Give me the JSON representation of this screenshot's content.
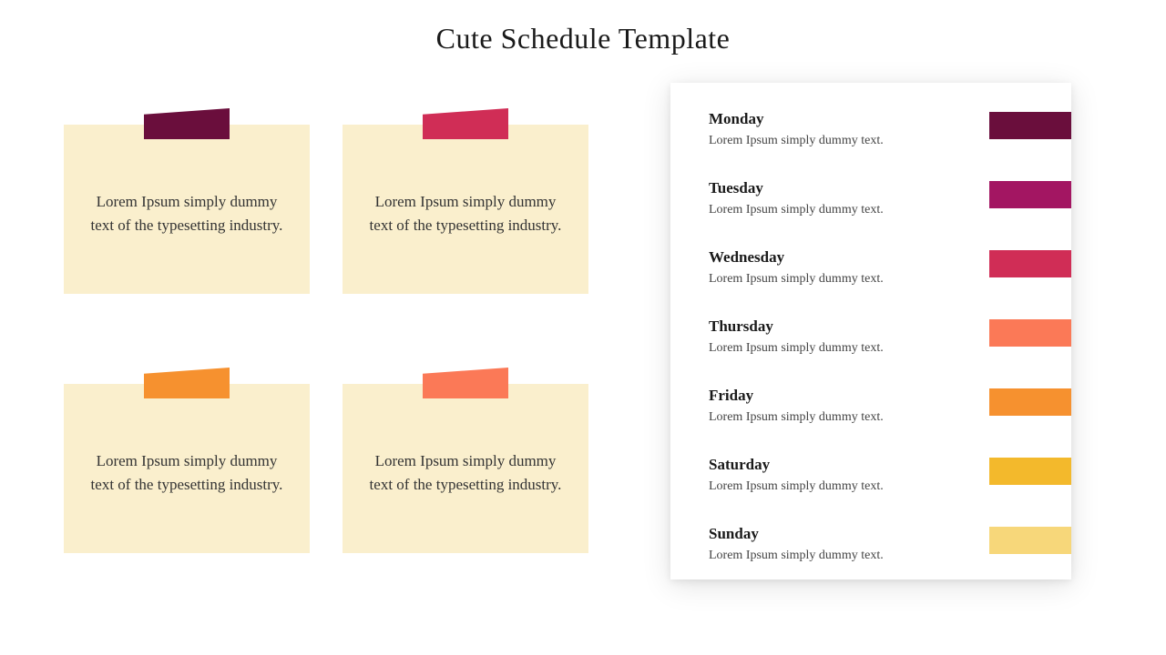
{
  "title": "Cute Schedule Template",
  "notes": [
    {
      "text": "Lorem Ipsum simply dummy text of the typesetting industry.",
      "color": "#6a0e3c"
    },
    {
      "text": "Lorem Ipsum simply dummy text of the typesetting industry.",
      "color": "#d02d56"
    },
    {
      "text": "Lorem Ipsum simply dummy text of the typesetting industry.",
      "color": "#f6912f"
    },
    {
      "text": "Lorem Ipsum simply dummy text of the typesetting industry.",
      "color": "#fb7957"
    }
  ],
  "days": [
    {
      "name": "Monday",
      "desc": "Lorem Ipsum simply dummy text.",
      "color": "#6a0e3c"
    },
    {
      "name": "Tuesday",
      "desc": "Lorem Ipsum simply dummy text.",
      "color": "#a31662"
    },
    {
      "name": "Wednesday",
      "desc": "Lorem Ipsum simply dummy text.",
      "color": "#d02d56"
    },
    {
      "name": "Thursday",
      "desc": "Lorem Ipsum simply dummy text.",
      "color": "#fb7957"
    },
    {
      "name": "Friday",
      "desc": "Lorem Ipsum simply dummy text.",
      "color": "#f6912f"
    },
    {
      "name": "Saturday",
      "desc": "Lorem Ipsum simply dummy text.",
      "color": "#f3b92c"
    },
    {
      "name": "Sunday",
      "desc": "Lorem Ipsum simply dummy text.",
      "color": "#f7d77a"
    }
  ]
}
